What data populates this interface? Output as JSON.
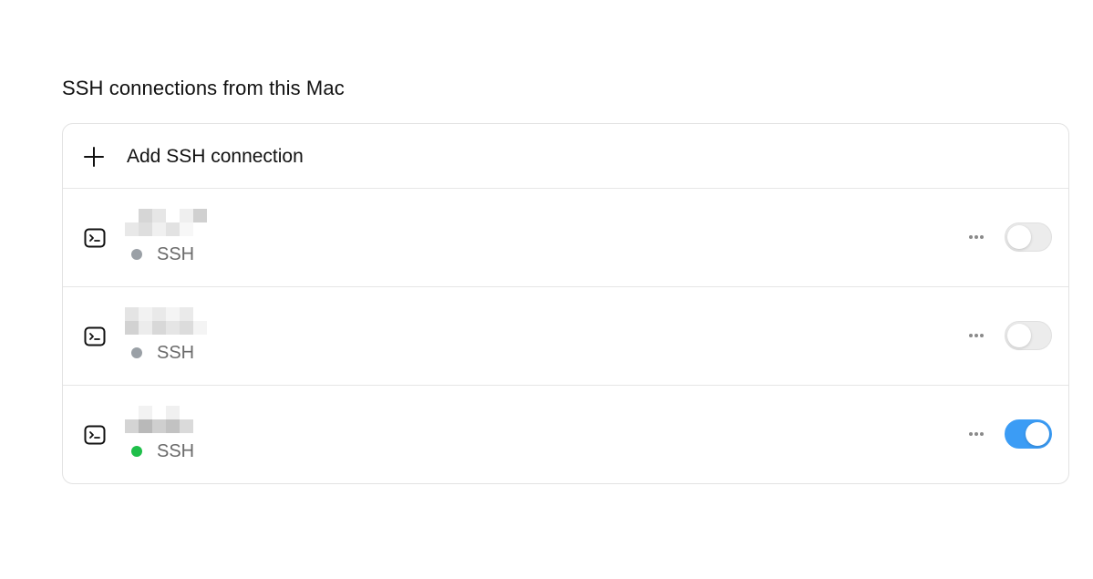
{
  "section": {
    "title": "SSH connections from this Mac"
  },
  "add_connection": {
    "label": "Add SSH connection",
    "icon": "plus-icon"
  },
  "connections": [
    {
      "host": "",
      "host_redacted": true,
      "protocol": "SSH",
      "status": "inactive",
      "status_color": "#9aa0a6",
      "enabled": false,
      "icon": "terminal-icon"
    },
    {
      "host": "",
      "host_redacted": true,
      "protocol": "SSH",
      "status": "inactive",
      "status_color": "#9aa0a6",
      "enabled": false,
      "icon": "terminal-icon"
    },
    {
      "host": "",
      "host_redacted": true,
      "protocol": "SSH",
      "status": "connected",
      "status_color": "#1fbf4a",
      "enabled": true,
      "icon": "terminal-icon"
    }
  ],
  "colors": {
    "toggle_on": "#3b9cf5",
    "toggle_off": "#ececec",
    "border": "#e2e2e2"
  }
}
